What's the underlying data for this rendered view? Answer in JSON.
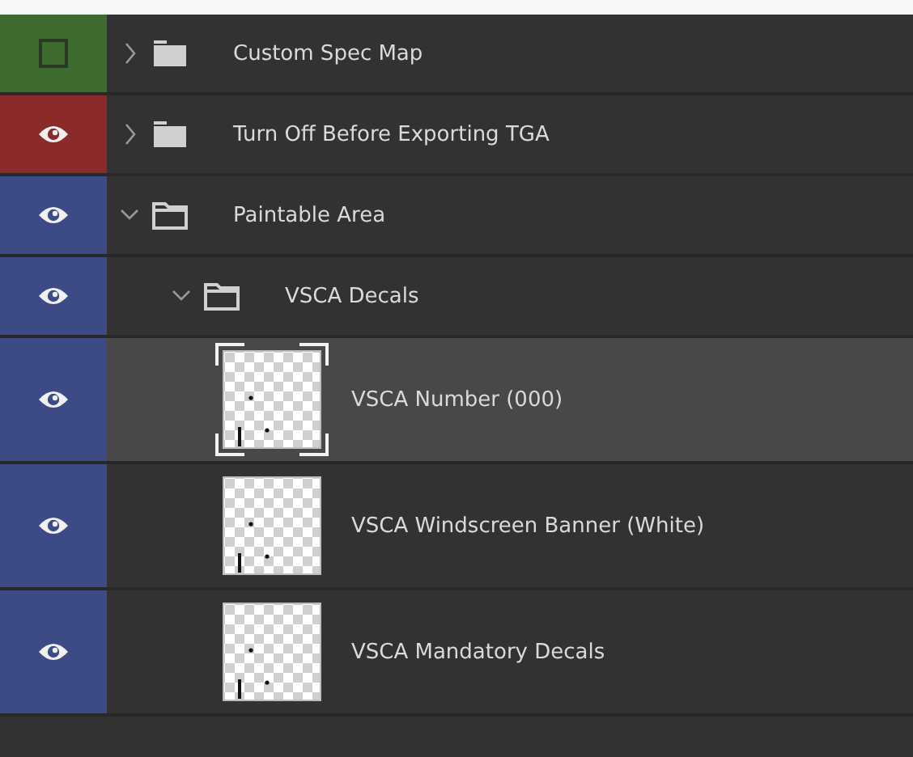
{
  "layers": [
    {
      "kind": "group",
      "name": "Custom Spec Map",
      "visible": false,
      "expanded": false,
      "color": "#3e6b2e"
    },
    {
      "kind": "group",
      "name": "Turn Off Before Exporting TGA",
      "visible": true,
      "expanded": false,
      "color": "#8b2b29"
    },
    {
      "kind": "group",
      "name": "Paintable Area",
      "visible": true,
      "expanded": true,
      "color": "#3c4a86",
      "children": [
        {
          "kind": "group",
          "name": "VSCA Decals",
          "visible": true,
          "expanded": true,
          "color": "#3c4a86",
          "children": [
            {
              "kind": "layer",
              "name": "VSCA Number (000)",
              "visible": true,
              "selected": true,
              "color": "#3c4a86"
            },
            {
              "kind": "layer",
              "name": "VSCA Windscreen Banner (White)",
              "visible": true,
              "selected": false,
              "color": "#3c4a86"
            },
            {
              "kind": "layer",
              "name": "VSCA Mandatory Decals",
              "visible": true,
              "selected": false,
              "color": "#3c4a86"
            }
          ]
        }
      ]
    }
  ]
}
